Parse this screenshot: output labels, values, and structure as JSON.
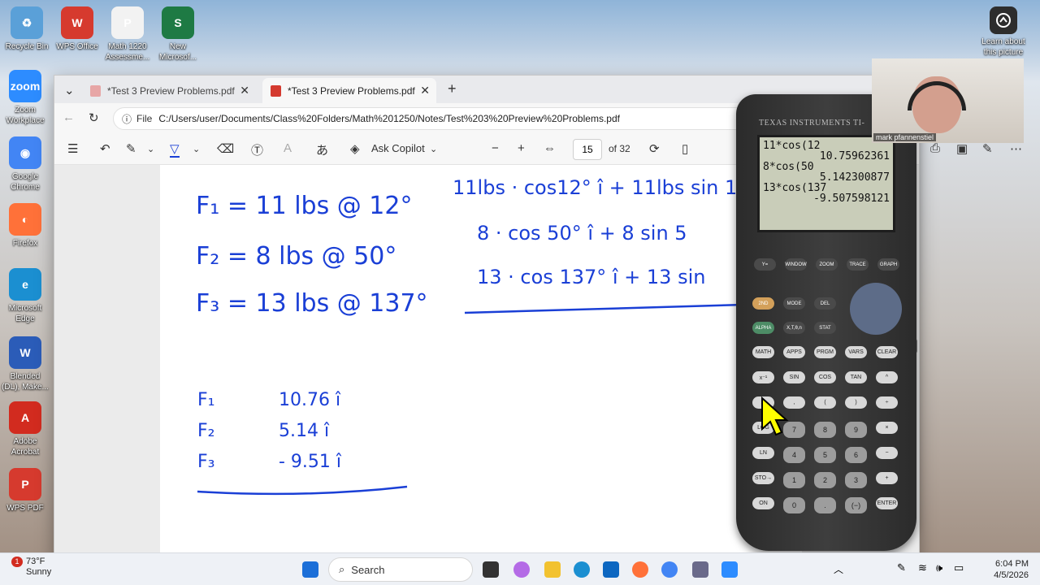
{
  "desktop": {
    "icons": [
      {
        "label": "Recycle Bin",
        "color": "#5aa0d8",
        "glyph": "♻"
      },
      {
        "label": "WPS Office",
        "color": "#d63a2e",
        "glyph": "W"
      },
      {
        "label": "Math 1220\nAssessme...",
        "color": "#f2f2f2",
        "glyph": "P"
      },
      {
        "label": "New\nMicrosof...",
        "color": "#1e7a44",
        "glyph": "S"
      },
      {
        "label": "Zoom\nWorkplace",
        "color": "#2d8cff",
        "glyph": "zoom"
      },
      {
        "label": "Google\nChrome",
        "color": "#4285f4",
        "glyph": "◉"
      },
      {
        "label": "Firefox",
        "color": "#ff7139",
        "glyph": "◐"
      },
      {
        "label": "Microsoft\nEdge",
        "color": "#1b8fd1",
        "glyph": "e"
      },
      {
        "label": "Blended\n(DL), Make...",
        "color": "#2b5cb8",
        "glyph": "W"
      },
      {
        "label": "Adobe\nAcrobat",
        "color": "#d22b1f",
        "glyph": "A"
      },
      {
        "label": "WPS PDF",
        "color": "#d63a2e",
        "glyph": "P"
      }
    ],
    "right_icon": {
      "label": "Learn about\nthis picture"
    }
  },
  "browser": {
    "tabs": [
      {
        "title": "*Test 3 Preview Problems.pdf"
      },
      {
        "title": "*Test 3 Preview Problems.pdf"
      }
    ],
    "file_label": "File",
    "address": "C:/Users/user/Documents/Class%20Folders/Math%201250/Notes/Test%203%20Preview%20Problems.pdf",
    "toolbar": {
      "ask_copilot": "Ask Copilot",
      "page_number": "15",
      "page_total": "of 32"
    }
  },
  "notes": {
    "left_lines": [
      "F₁ = 11 lbs @ 12°",
      "F₂ = 8 lbs @ 50°",
      "F₃ = 13 lbs @ 137°"
    ],
    "right_lines": [
      "11lbs · cos12° î + 11lbs sin 12",
      "8 · cos 50° î + 8 sin 5",
      "13 · cos 137° î + 13 sin"
    ],
    "result_labels": [
      "F₁",
      "F₂",
      "F₃"
    ],
    "result_values": [
      "10.76 î",
      "5.14 î",
      "- 9.51 î"
    ],
    "ink_color": "#1a3fd6"
  },
  "calculator": {
    "brand": "TEXAS INSTRUMENTS  TI-",
    "screen": [
      "11*cos(12",
      "10.75962361",
      "8*cos(50",
      "5.142300877",
      "13*cos(137",
      "-9.507598121"
    ],
    "fn_keys": [
      "Y=",
      "WINDOW",
      "ZOOM",
      "TRACE",
      "GRAPH"
    ],
    "keys": [
      [
        "2ND",
        "MODE",
        "DEL"
      ],
      [
        "ALPHA",
        "X,T,θ,n",
        "STAT"
      ],
      [
        "MATH",
        "APPS",
        "PRGM",
        "VARS",
        "CLEAR"
      ],
      [
        "x⁻¹",
        "SIN",
        "COS",
        "TAN",
        "^"
      ],
      [
        "x²",
        ",",
        "(",
        ")",
        "÷"
      ],
      [
        "LOG",
        "7",
        "8",
        "9",
        "×"
      ],
      [
        "LN",
        "4",
        "5",
        "6",
        "−"
      ],
      [
        "STO→",
        "1",
        "2",
        "3",
        "+"
      ],
      [
        "ON",
        "0",
        ".",
        "(−)",
        "ENTER"
      ]
    ]
  },
  "video": {
    "name": "mark pfannenstiel"
  },
  "taskbar": {
    "weather_temp": "73°F",
    "weather_desc": "Sunny",
    "weather_badge": "1",
    "search_placeholder": "Search",
    "time": "6:04 PM",
    "date": "4/5/2026"
  }
}
